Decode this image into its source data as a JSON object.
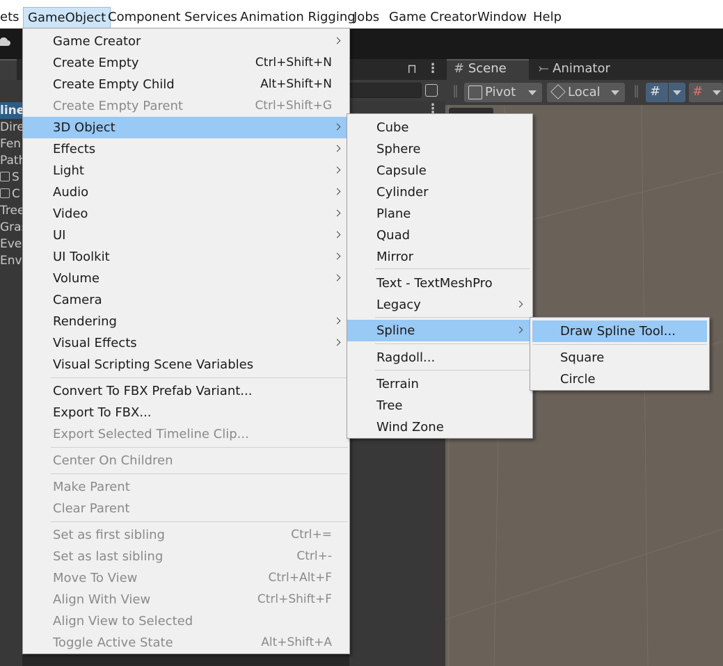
{
  "menubar": {
    "items": [
      "ets",
      "GameObject",
      "Component",
      "Services",
      "Animation Rigging",
      "Jobs",
      "Game Creator",
      "Window",
      "Help"
    ],
    "active": "GameObject"
  },
  "hierarchy": {
    "rows": [
      "line",
      "Dire",
      "Fen",
      "Path",
      "S",
      "C",
      "Tree",
      "Gras",
      "Eve",
      "Env"
    ]
  },
  "scene": {
    "tabs": [
      "Scene",
      "Animator"
    ],
    "pivot_label": "Pivot",
    "local_label": "Local"
  },
  "gameobject_menu": {
    "items": [
      {
        "label": "Game Creator",
        "shortcut": "",
        "submenu": true,
        "disabled": false
      },
      {
        "label": "Create Empty",
        "shortcut": "Ctrl+Shift+N",
        "submenu": false,
        "disabled": false
      },
      {
        "label": "Create Empty Child",
        "shortcut": "Alt+Shift+N",
        "submenu": false,
        "disabled": false
      },
      {
        "label": "Create Empty Parent",
        "shortcut": "Ctrl+Shift+G",
        "submenu": false,
        "disabled": true
      },
      {
        "label": "3D Object",
        "shortcut": "",
        "submenu": true,
        "disabled": false,
        "highlighted": true
      },
      {
        "label": "Effects",
        "shortcut": "",
        "submenu": true,
        "disabled": false
      },
      {
        "label": "Light",
        "shortcut": "",
        "submenu": true,
        "disabled": false
      },
      {
        "label": "Audio",
        "shortcut": "",
        "submenu": true,
        "disabled": false
      },
      {
        "label": "Video",
        "shortcut": "",
        "submenu": true,
        "disabled": false
      },
      {
        "label": "UI",
        "shortcut": "",
        "submenu": true,
        "disabled": false
      },
      {
        "label": "UI Toolkit",
        "shortcut": "",
        "submenu": true,
        "disabled": false
      },
      {
        "label": "Volume",
        "shortcut": "",
        "submenu": true,
        "disabled": false
      },
      {
        "label": "Camera",
        "shortcut": "",
        "submenu": false,
        "disabled": false
      },
      {
        "label": "Rendering",
        "shortcut": "",
        "submenu": true,
        "disabled": false
      },
      {
        "label": "Visual Effects",
        "shortcut": "",
        "submenu": true,
        "disabled": false
      },
      {
        "label": "Visual Scripting Scene Variables",
        "shortcut": "",
        "submenu": false,
        "disabled": false
      },
      {
        "label": "Convert To FBX Prefab Variant...",
        "shortcut": "",
        "submenu": false,
        "disabled": false
      },
      {
        "label": "Export To FBX...",
        "shortcut": "",
        "submenu": false,
        "disabled": false
      },
      {
        "label": "Export Selected Timeline Clip...",
        "shortcut": "",
        "submenu": false,
        "disabled": true
      },
      {
        "label": "Center On Children",
        "shortcut": "",
        "submenu": false,
        "disabled": true
      },
      {
        "label": "Make Parent",
        "shortcut": "",
        "submenu": false,
        "disabled": true
      },
      {
        "label": "Clear Parent",
        "shortcut": "",
        "submenu": false,
        "disabled": true
      },
      {
        "label": "Set as first sibling",
        "shortcut": "Ctrl+=",
        "submenu": false,
        "disabled": true
      },
      {
        "label": "Set as last sibling",
        "shortcut": "Ctrl+-",
        "submenu": false,
        "disabled": true
      },
      {
        "label": "Move To View",
        "shortcut": "Ctrl+Alt+F",
        "submenu": false,
        "disabled": true
      },
      {
        "label": "Align With View",
        "shortcut": "Ctrl+Shift+F",
        "submenu": false,
        "disabled": true
      },
      {
        "label": "Align View to Selected",
        "shortcut": "",
        "submenu": false,
        "disabled": true
      },
      {
        "label": "Toggle Active State",
        "shortcut": "Alt+Shift+A",
        "submenu": false,
        "disabled": true
      }
    ]
  },
  "object3d_menu": {
    "items": [
      {
        "label": "Cube",
        "submenu": false
      },
      {
        "label": "Sphere",
        "submenu": false
      },
      {
        "label": "Capsule",
        "submenu": false
      },
      {
        "label": "Cylinder",
        "submenu": false
      },
      {
        "label": "Plane",
        "submenu": false
      },
      {
        "label": "Quad",
        "submenu": false
      },
      {
        "label": "Mirror",
        "submenu": false
      },
      {
        "label": "Text - TextMeshPro",
        "submenu": false
      },
      {
        "label": "Legacy",
        "submenu": true
      },
      {
        "label": "Spline",
        "submenu": true,
        "highlighted": true
      },
      {
        "label": "Ragdoll...",
        "submenu": false
      },
      {
        "label": "Terrain",
        "submenu": false
      },
      {
        "label": "Tree",
        "submenu": false
      },
      {
        "label": "Wind Zone",
        "submenu": false
      }
    ]
  },
  "spline_menu": {
    "items": [
      {
        "label": "Draw Spline Tool...",
        "highlighted": true
      },
      {
        "label": "Square"
      },
      {
        "label": "Circle"
      }
    ]
  },
  "colors": {
    "menu_bg": "#f0f0f0",
    "highlight": "#99c9f5",
    "disabled_text": "#8a8a8a",
    "scene_bg": "#6a6159",
    "dark_panel": "#383838"
  }
}
